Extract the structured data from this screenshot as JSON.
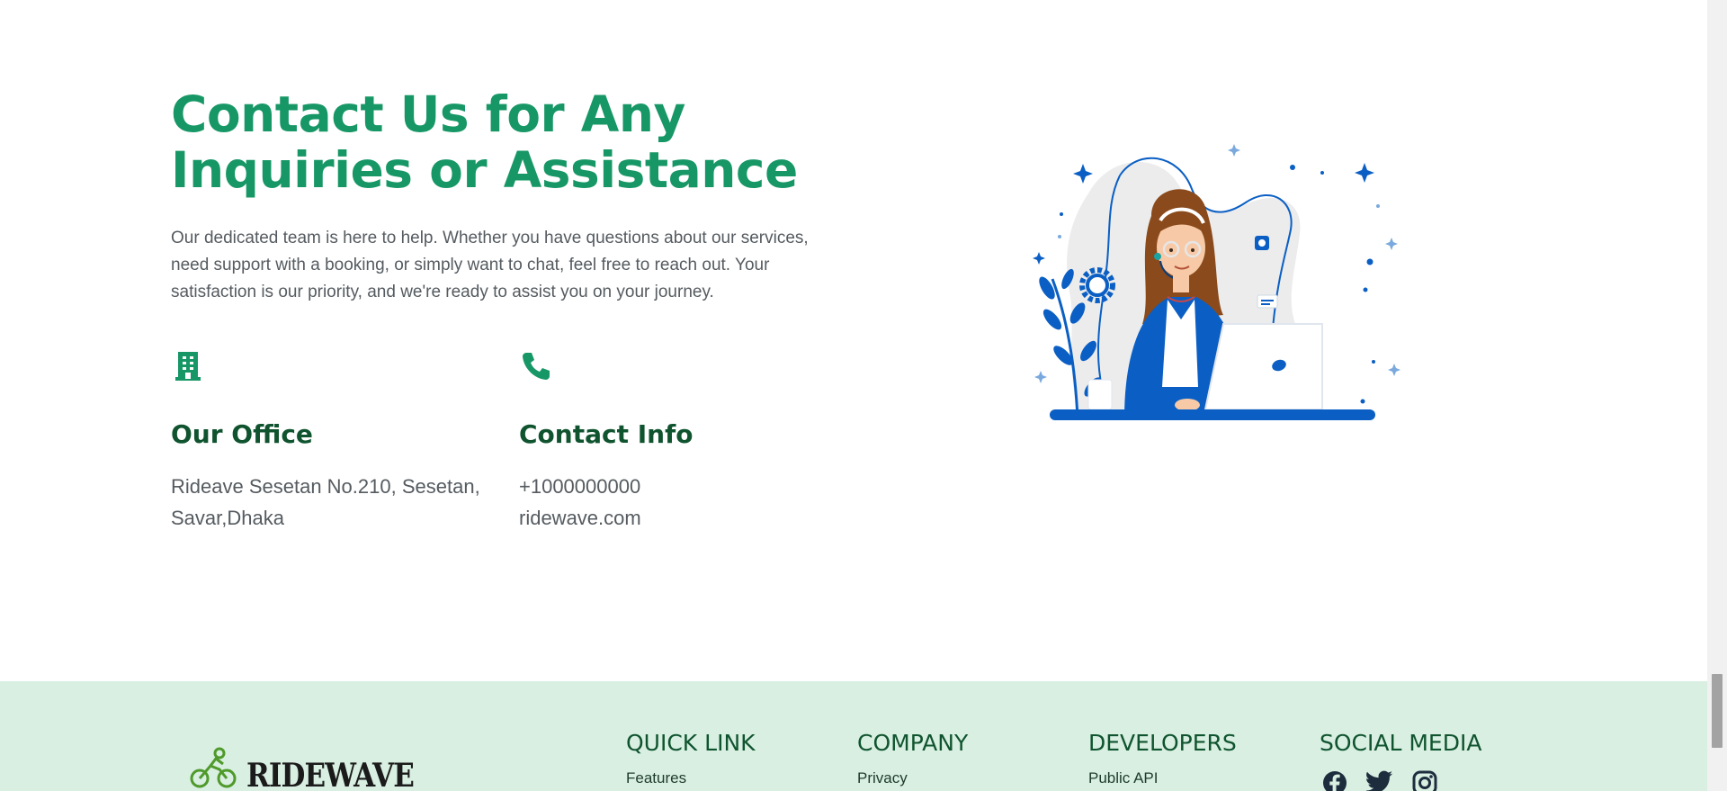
{
  "contact": {
    "heading": "Contact Us for Any Inquiries or Assistance",
    "intro": "Our dedicated team is here to help. Whether you have questions about our services, need support with a booking, or simply want to chat, feel free to reach out. Your satisfaction is our priority, and we're ready to assist you on your journey.",
    "office": {
      "icon": "building-icon",
      "title": "Our Office",
      "lines": [
        "Rideave Sesetan No.210, Sesetan,",
        "Savar,Dhaka"
      ]
    },
    "info": {
      "icon": "phone-icon",
      "title": "Contact Info",
      "lines": [
        "+1000000000",
        "ridewave.com"
      ]
    },
    "illustration": "customer-support-illustration"
  },
  "footer": {
    "logo_text": "RIDEWAVE",
    "logo_icon": "cyclist-icon",
    "columns": [
      {
        "title": "QUICK LINK",
        "links": [
          "Features"
        ]
      },
      {
        "title": "COMPANY",
        "links": [
          "Privacy"
        ]
      },
      {
        "title": "DEVELOPERS",
        "links": [
          "Public API"
        ]
      },
      {
        "title": "SOCIAL MEDIA",
        "icons": [
          "facebook-icon",
          "twitter-icon",
          "instagram-icon"
        ]
      }
    ]
  },
  "colors": {
    "heading": "#179766",
    "title_dark_green": "#10542f",
    "body_text": "#555b60",
    "footer_bg": "#d8efe2",
    "illustration_blue": "#0b5fc4"
  }
}
